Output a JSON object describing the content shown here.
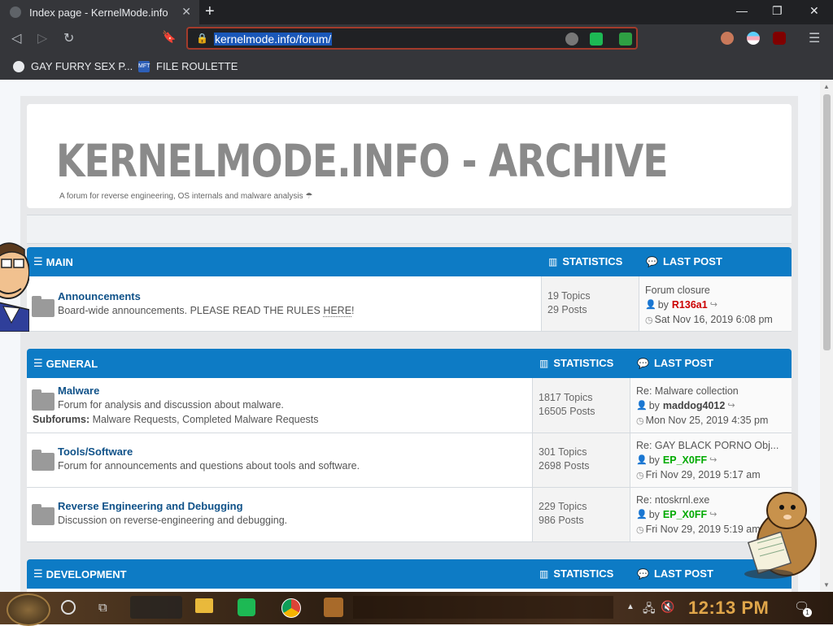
{
  "browser": {
    "tab_title": "Index page - KernelMode.info",
    "tab_close": "✕",
    "new_tab": "+",
    "window": {
      "minimize": "—",
      "maximize": "❐",
      "close": "✕"
    },
    "url": "kernelmode.info/forum/",
    "bookmarks": [
      {
        "label": "GAY FURRY SEX P..."
      },
      {
        "label": "FILE ROULETTE",
        "icon_text": "MFT"
      }
    ]
  },
  "site": {
    "title": "KERNELMODE.INFO - ARCHIVE",
    "description": "A forum for reverse engineering, OS internals and malware analysis ☂"
  },
  "sections": [
    {
      "title": "MAIN",
      "stats_header": "STATISTICS",
      "last_header": "LAST POST",
      "forums": [
        {
          "name": "Announcements",
          "description": "Board-wide announcements. PLEASE READ THE RULES ",
          "rules_link": "HERE",
          "description_end": "!",
          "topics": "19 Topics",
          "posts": "29 Posts",
          "last_title": "Forum closure",
          "by": "by",
          "last_author": "R136a1",
          "author_color": "#cc0000",
          "last_date": "Sat Nov 16, 2019 6:08 pm"
        }
      ]
    },
    {
      "title": "GENERAL",
      "stats_header": "STATISTICS",
      "last_header": "LAST POST",
      "forums": [
        {
          "name": "Malware",
          "description": "Forum for analysis and discussion about malware.",
          "subforums_label": "Subforums:",
          "subforums": "Malware Requests, Completed Malware Requests",
          "topics": "1817 Topics",
          "posts": "16505 Posts",
          "last_title": "Re: Malware collection",
          "by": "by",
          "last_author": "maddog4012",
          "author_color": "#444444",
          "last_date": "Mon Nov 25, 2019 4:35 pm"
        },
        {
          "name": "Tools/Software",
          "description": "Forum for announcements and questions about tools and software.",
          "topics": "301 Topics",
          "posts": "2698 Posts",
          "last_title": "Re: GAY BLACK PORNO Obj...",
          "by": "by",
          "last_author": "EP_X0FF",
          "author_color": "#00aa00",
          "last_date": "Fri Nov 29, 2019 5:17 am"
        },
        {
          "name": "Reverse Engineering and Debugging",
          "description": "Discussion on reverse-engineering and debugging.",
          "topics": "229 Topics",
          "posts": "986 Posts",
          "last_title": "Re: ntoskrnl.exe",
          "by": "by",
          "last_author": "EP_X0FF",
          "author_color": "#00aa00",
          "last_date": "Fri Nov 29, 2019 5:19 am"
        }
      ]
    },
    {
      "title": "DEVELOPMENT",
      "stats_header": "STATISTICS",
      "last_header": "LAST POST",
      "forums": []
    }
  ],
  "taskbar": {
    "clock": "12:13 PM",
    "notification_count": "1"
  },
  "colors": {
    "section_header": "#0d7bc5",
    "forum_link": "#105289",
    "omnibox_border": "#a33b2b"
  }
}
